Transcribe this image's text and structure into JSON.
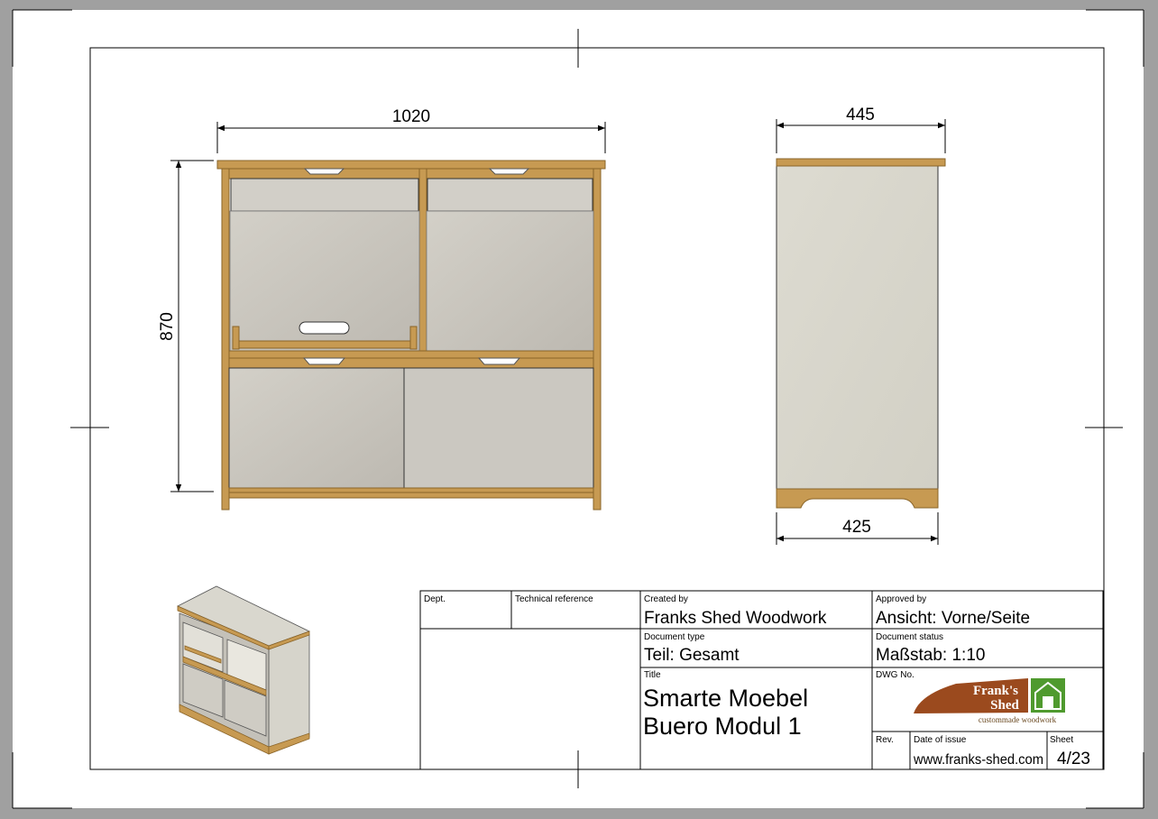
{
  "dimensions": {
    "front_width": "1020",
    "front_height": "870",
    "side_depth_top": "445",
    "side_depth_bottom": "425"
  },
  "title_block": {
    "dept_label": "Dept.",
    "tech_ref_label": "Technical reference",
    "created_by_label": "Created by",
    "created_by": "Franks Shed Woodwork",
    "approved_by_label": "Approved by",
    "approved_by": "Ansicht: Vorne/Seite",
    "doc_type_label": "Document type",
    "doc_type": "Teil: Gesamt",
    "doc_status_label": "Document status",
    "doc_status": "Maßstab: 1:10",
    "title_label": "Title",
    "title_line1": "Smarte Moebel",
    "title_line2": "Buero Modul 1",
    "dwg_label": "DWG No.",
    "rev_label": "Rev.",
    "date_label": "Date of issue",
    "date_value": "www.franks-shed.com",
    "sheet_label": "Sheet",
    "sheet_value": "4/23"
  },
  "logo": {
    "line1": "Frank's",
    "line2": "Shed",
    "tagline": "custommade woodwork"
  },
  "colors": {
    "wood": "#c79a52",
    "wood_edge": "#8a6428",
    "panel": "#c9c5bd",
    "side_panel": "#dcdad0",
    "logo_brown": "#9b4a1e",
    "logo_green": "#4f9a2e"
  }
}
